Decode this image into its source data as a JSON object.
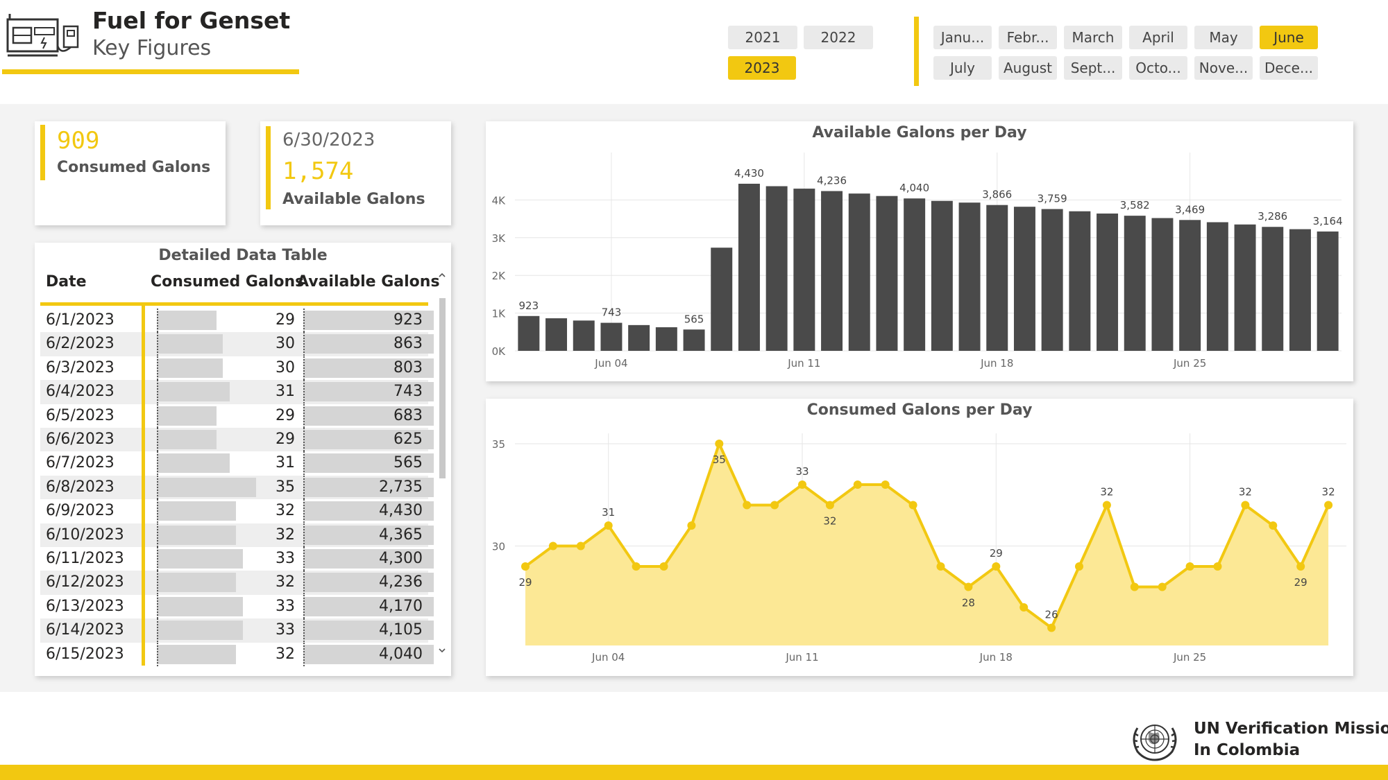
{
  "header": {
    "title": "Fuel for Genset",
    "subtitle": "Key Figures",
    "icon": "generator-icon"
  },
  "year_slicer": {
    "options": [
      {
        "label": "2021",
        "selected": false
      },
      {
        "label": "2022",
        "selected": false
      },
      {
        "label": "2023",
        "selected": true
      }
    ]
  },
  "month_slicer": {
    "options": [
      {
        "label": "Janu...",
        "selected": false
      },
      {
        "label": "Febr...",
        "selected": false
      },
      {
        "label": "March",
        "selected": false
      },
      {
        "label": "April",
        "selected": false
      },
      {
        "label": "May",
        "selected": false
      },
      {
        "label": "June",
        "selected": true
      },
      {
        "label": "July",
        "selected": false
      },
      {
        "label": "August",
        "selected": false
      },
      {
        "label": "Sept...",
        "selected": false
      },
      {
        "label": "Octo...",
        "selected": false
      },
      {
        "label": "Nove...",
        "selected": false
      },
      {
        "label": "Dece...",
        "selected": false
      }
    ]
  },
  "kpi_consumed": {
    "value": "909",
    "label": "Consumed Galons"
  },
  "kpi_available": {
    "date": "6/30/2023",
    "value": "1,574",
    "label": "Available Galons"
  },
  "table": {
    "title": "Detailed Data Table",
    "columns": [
      "Date",
      "Consumed Galons",
      "Available Galons"
    ],
    "rows": [
      {
        "date": "6/1/2023",
        "consumed": "29",
        "available": "923"
      },
      {
        "date": "6/2/2023",
        "consumed": "30",
        "available": "863"
      },
      {
        "date": "6/3/2023",
        "consumed": "30",
        "available": "803"
      },
      {
        "date": "6/4/2023",
        "consumed": "31",
        "available": "743"
      },
      {
        "date": "6/5/2023",
        "consumed": "29",
        "available": "683"
      },
      {
        "date": "6/6/2023",
        "consumed": "29",
        "available": "625"
      },
      {
        "date": "6/7/2023",
        "consumed": "31",
        "available": "565"
      },
      {
        "date": "6/8/2023",
        "consumed": "35",
        "available": "2,735"
      },
      {
        "date": "6/9/2023",
        "consumed": "32",
        "available": "4,430"
      },
      {
        "date": "6/10/2023",
        "consumed": "32",
        "available": "4,365"
      },
      {
        "date": "6/11/2023",
        "consumed": "33",
        "available": "4,300"
      },
      {
        "date": "6/12/2023",
        "consumed": "32",
        "available": "4,236"
      },
      {
        "date": "6/13/2023",
        "consumed": "33",
        "available": "4,170"
      },
      {
        "date": "6/14/2023",
        "consumed": "33",
        "available": "4,105"
      },
      {
        "date": "6/15/2023",
        "consumed": "32",
        "available": "4,040"
      }
    ]
  },
  "chart_data": [
    {
      "type": "bar",
      "title": "Available Galons per Day",
      "bar_color": "#4a4a4a",
      "xlabel": "",
      "ylabel": "",
      "ylim": [
        0,
        5000
      ],
      "yticks": [
        0,
        1000,
        2000,
        3000,
        4000
      ],
      "ytick_labels": [
        "0K",
        "1K",
        "2K",
        "3K",
        "4K"
      ],
      "x_ticks": [
        {
          "day": 4,
          "label": "Jun 04"
        },
        {
          "day": 11,
          "label": "Jun 11"
        },
        {
          "day": 18,
          "label": "Jun 18"
        },
        {
          "day": 25,
          "label": "Jun 25"
        }
      ],
      "days": [
        1,
        2,
        3,
        4,
        5,
        6,
        7,
        8,
        9,
        10,
        11,
        12,
        13,
        14,
        15,
        16,
        17,
        18,
        19,
        20,
        21,
        22,
        23,
        24,
        25,
        26,
        27,
        28,
        29,
        30
      ],
      "values": [
        923,
        863,
        803,
        743,
        683,
        625,
        565,
        2735,
        4430,
        4365,
        4300,
        4236,
        4170,
        4105,
        4040,
        3975,
        3930,
        3866,
        3820,
        3759,
        3700,
        3640,
        3582,
        3520,
        3469,
        3410,
        3350,
        3286,
        3225,
        3164
      ],
      "data_labels": [
        {
          "index": 0,
          "text": "923"
        },
        {
          "index": 3,
          "text": "743"
        },
        {
          "index": 6,
          "text": "565"
        },
        {
          "index": 8,
          "text": "4,430"
        },
        {
          "index": 11,
          "text": "4,236"
        },
        {
          "index": 14,
          "text": "4,040"
        },
        {
          "index": 17,
          "text": "3,866"
        },
        {
          "index": 19,
          "text": "3,759"
        },
        {
          "index": 22,
          "text": "3,582"
        },
        {
          "index": 24,
          "text": "3,469"
        },
        {
          "index": 27,
          "text": "3,286"
        },
        {
          "index": 29,
          "text": "3,164"
        }
      ]
    },
    {
      "type": "area",
      "title": "Consumed Galons per Day",
      "line_color": "#F2C811",
      "fill_color": "#FCE895",
      "xlabel": "",
      "ylabel": "",
      "ylim": [
        25.8,
        36.0
      ],
      "yticks": [
        30,
        35
      ],
      "ytick_labels": [
        "30",
        "35"
      ],
      "x_ticks": [
        {
          "day": 4,
          "label": "Jun 04"
        },
        {
          "day": 11,
          "label": "Jun 11"
        },
        {
          "day": 18,
          "label": "Jun 18"
        },
        {
          "day": 25,
          "label": "Jun 25"
        }
      ],
      "days": [
        1,
        2,
        3,
        4,
        5,
        6,
        7,
        8,
        9,
        10,
        11,
        12,
        13,
        14,
        15,
        16,
        17,
        18,
        19,
        20,
        21,
        22,
        23,
        24,
        25,
        26,
        27,
        28,
        29,
        30
      ],
      "values": [
        29,
        30,
        30,
        31,
        29,
        29,
        31,
        35,
        32,
        32,
        33,
        32,
        33,
        33,
        32,
        29,
        28,
        29,
        27,
        26,
        29,
        32,
        28,
        28,
        29,
        29,
        32,
        31,
        29,
        32
      ],
      "data_labels": [
        {
          "index": 0,
          "text": "29",
          "pos": "below"
        },
        {
          "index": 3,
          "text": "31",
          "pos": "above"
        },
        {
          "index": 7,
          "text": "35",
          "pos": "below"
        },
        {
          "index": 10,
          "text": "33",
          "pos": "above"
        },
        {
          "index": 11,
          "text": "32",
          "pos": "below"
        },
        {
          "index": 16,
          "text": "28",
          "pos": "below"
        },
        {
          "index": 17,
          "text": "29",
          "pos": "above"
        },
        {
          "index": 19,
          "text": "26",
          "pos": "above"
        },
        {
          "index": 21,
          "text": "32",
          "pos": "above"
        },
        {
          "index": 26,
          "text": "32",
          "pos": "above"
        },
        {
          "index": 28,
          "text": "29",
          "pos": "below"
        },
        {
          "index": 29,
          "text": "32",
          "pos": "above"
        }
      ]
    }
  ],
  "footer": {
    "org_line1": "UN Verification Mission",
    "org_line2": "In Colombia",
    "emblem": "un-emblem-icon",
    "accent_color": "#F2C811"
  }
}
